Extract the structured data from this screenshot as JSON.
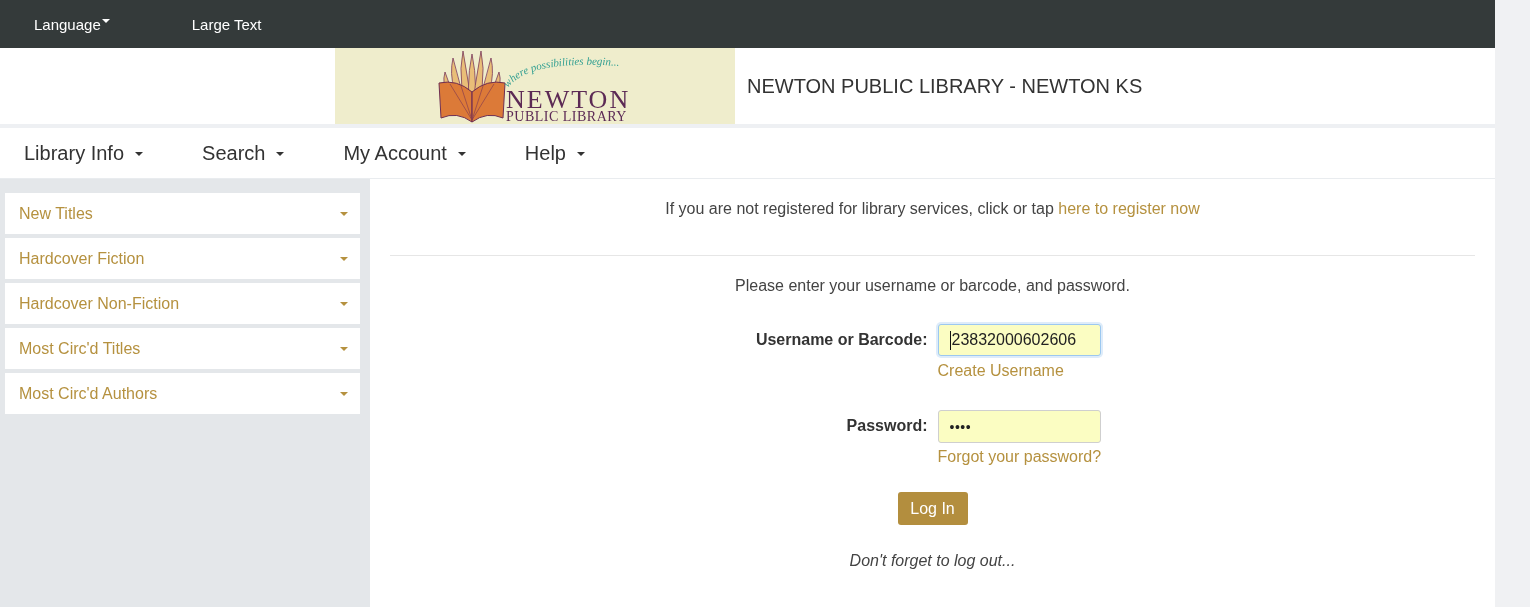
{
  "top_bar": {
    "items": [
      {
        "label": "Language",
        "kind": "dropdown"
      },
      {
        "label": "Large Text",
        "kind": "link"
      }
    ]
  },
  "header": {
    "logo": {
      "tagline": "where possibilities begin...",
      "name": "NEWTON",
      "subtitle": "PUBLIC LIBRARY"
    },
    "title": "NEWTON PUBLIC LIBRARY - NEWTON KS"
  },
  "nav": {
    "items": [
      {
        "label": "Library Info"
      },
      {
        "label": "Search"
      },
      {
        "label": "My Account"
      },
      {
        "label": "Help"
      }
    ]
  },
  "sidebar": {
    "items": [
      {
        "label": "New Titles"
      },
      {
        "label": "Hardcover Fiction"
      },
      {
        "label": "Hardcover Non-Fiction"
      },
      {
        "label": "Most Circ'd Titles"
      },
      {
        "label": "Most Circ'd Authors"
      }
    ]
  },
  "login": {
    "register_prompt": "If you are not registered for library services, click or tap",
    "register_link": "here to register now",
    "instructions": "Please enter your username or barcode, and password.",
    "fields": [
      {
        "kind": "text",
        "label": "Username or Barcode:",
        "value": "23832000602606",
        "focused": true,
        "link": "Create Username"
      },
      {
        "kind": "password",
        "label": "Password:",
        "value": "••••",
        "focused": false,
        "link": "Forgot your password?"
      }
    ],
    "button": "Log In",
    "note": "Don't forget to log out..."
  }
}
